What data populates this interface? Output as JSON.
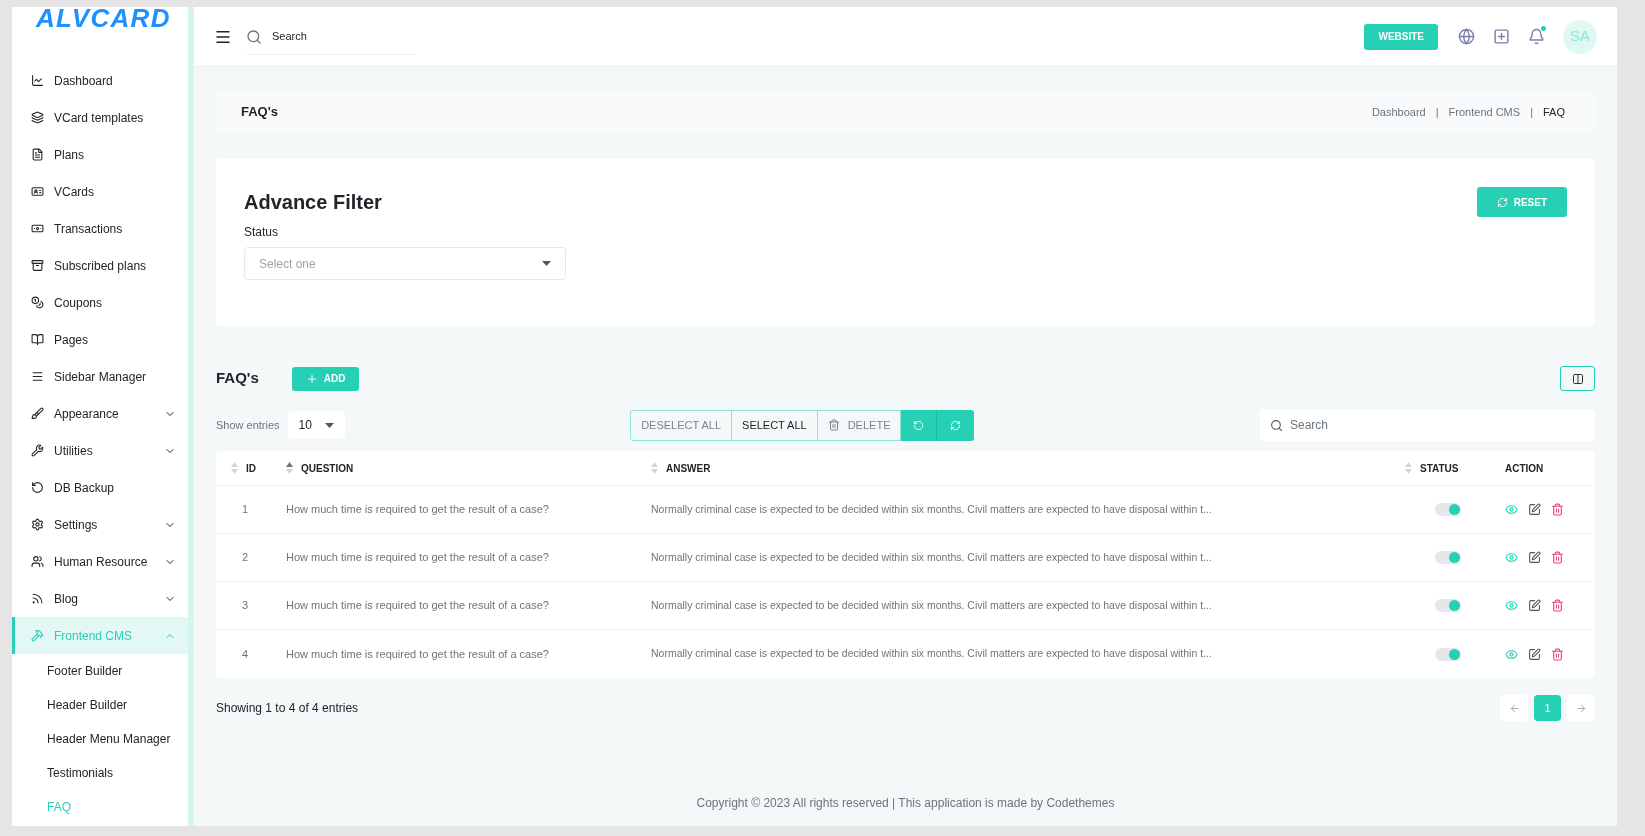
{
  "logo": "ALVCARD",
  "sidebar": {
    "items": [
      {
        "label": "Dashboard",
        "selected": false
      },
      {
        "label": "VCard templates",
        "selected": false
      },
      {
        "label": "Plans",
        "selected": false
      },
      {
        "label": "VCards",
        "selected": false
      },
      {
        "label": "Transactions",
        "selected": false
      },
      {
        "label": "Subscribed plans",
        "selected": false
      },
      {
        "label": "Coupons",
        "selected": false
      },
      {
        "label": "Pages",
        "selected": false
      },
      {
        "label": "Sidebar Manager",
        "selected": false
      },
      {
        "label": "Appearance",
        "selected": false,
        "expanded": false
      },
      {
        "label": "Utilities",
        "selected": false,
        "expanded": false
      },
      {
        "label": "DB Backup",
        "selected": false
      },
      {
        "label": "Settings",
        "selected": false,
        "expanded": false
      },
      {
        "label": "Human Resource",
        "selected": false,
        "expanded": false
      },
      {
        "label": "Blog",
        "selected": false,
        "expanded": false
      },
      {
        "label": "Frontend CMS",
        "selected": true,
        "expanded": true,
        "children": [
          {
            "label": "Footer Builder",
            "selected": false
          },
          {
            "label": "Header Builder",
            "selected": false
          },
          {
            "label": "Header Menu Manager",
            "selected": false
          },
          {
            "label": "Testimonials",
            "selected": false
          },
          {
            "label": "FAQ",
            "selected": true
          }
        ]
      }
    ]
  },
  "topbar": {
    "search": {
      "placeholder": "Search"
    },
    "website_button": "WEBSITE",
    "avatar": "SA",
    "notification_dot": true
  },
  "page_header": {
    "title": "FAQ's",
    "breadcrumbs": [
      "Dashboard",
      "|",
      "Frontend CMS",
      "|",
      "FAQ"
    ]
  },
  "filter": {
    "title": "Advance Filter",
    "reset_button": "RESET",
    "status_label": "Status",
    "status_select": {
      "placeholder": "Select one"
    }
  },
  "list": {
    "title": "FAQ's",
    "add_button": "ADD",
    "show_entries_label": "Show entries",
    "page_size": "10",
    "bulk_buttons": [
      "DESELECT ALL",
      "SELECT ALL",
      "DELETE"
    ],
    "search": {
      "placeholder": "Search"
    },
    "table": {
      "columns": [
        {
          "label": "ID",
          "sortable": true,
          "sorted": false
        },
        {
          "label": "QUESTION",
          "sortable": true,
          "sorted": true
        },
        {
          "label": "ANSWER",
          "sortable": true,
          "sorted": false
        },
        {
          "label": "STATUS",
          "sortable": true,
          "sorted": false
        },
        {
          "label": "ACTION",
          "sortable": false
        }
      ],
      "rows": [
        {
          "id": "1",
          "question": "How much time is required to get the result of a case?",
          "answer": "Normally criminal case is expected to be decided within six months. Civil matters are expected to have disposal within t...",
          "on": true
        },
        {
          "id": "2",
          "question": "How much time is required to get the result of a case?",
          "answer": "Normally criminal case is expected to be decided within six months. Civil matters are expected to have disposal within t...",
          "on": true
        },
        {
          "id": "3",
          "question": "How much time is required to get the result of a case?",
          "answer": "Normally criminal case is expected to be decided within six months. Civil matters are expected to have disposal within t...",
          "on": true
        },
        {
          "id": "4",
          "question": "How much time is required to get the result of a case?",
          "answer": "Normally criminal case is expected to be decided within six months. Civil matters are expected to have disposal within t...",
          "on": true
        }
      ]
    },
    "showing": "Showing 1 to 4 of 4 entries",
    "pages": [
      {
        "label": "1",
        "selected": true
      }
    ]
  },
  "footer": "Copyright © 2023 All rights reserved | This application is made by Codethemes"
}
